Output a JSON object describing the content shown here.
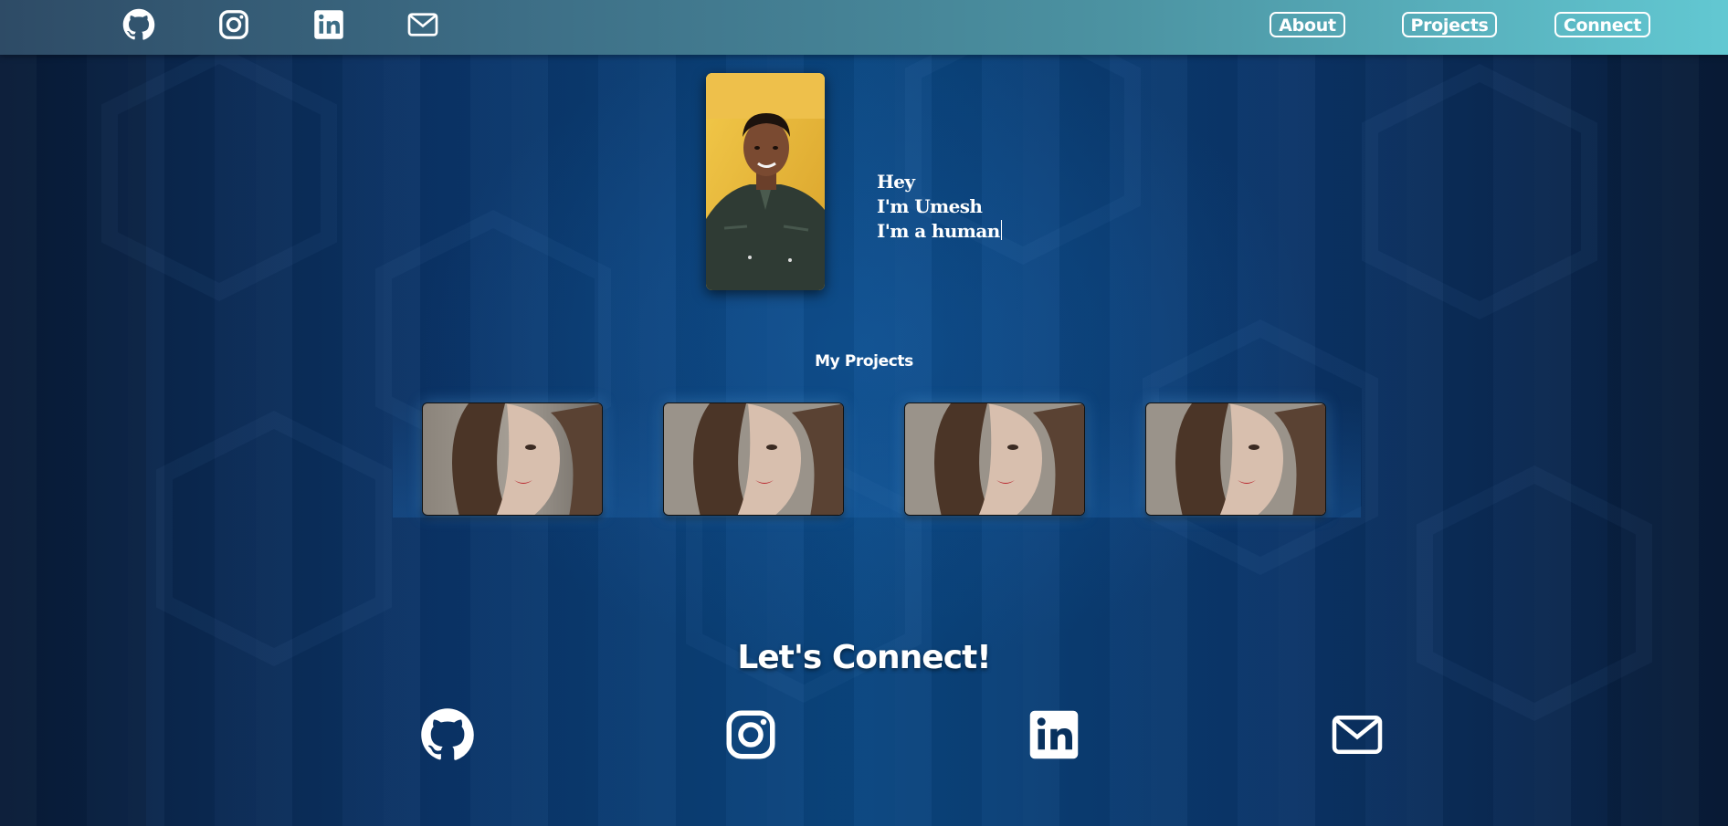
{
  "theme": {
    "accent": "#62c8d2",
    "topbar_start": "#2e4b66",
    "background": "#062a52",
    "text": "#ffffff"
  },
  "topbar": {
    "social_icons": [
      "github-icon",
      "instagram-icon",
      "linkedin-icon",
      "mail-icon"
    ],
    "nav": {
      "about": "About",
      "projects": "Projects",
      "connect": "Connect"
    }
  },
  "hero": {
    "portrait": "profile-photo",
    "lines": [
      "Hey",
      "I'm Umesh",
      "I'm a human"
    ]
  },
  "projects": {
    "title": "My Projects",
    "cards": [
      "project-thumbnail",
      "project-thumbnail",
      "project-thumbnail",
      "project-thumbnail"
    ]
  },
  "connect": {
    "title": "Let's Connect!",
    "icons": [
      "github-icon",
      "instagram-icon",
      "linkedin-icon",
      "mail-icon"
    ]
  }
}
